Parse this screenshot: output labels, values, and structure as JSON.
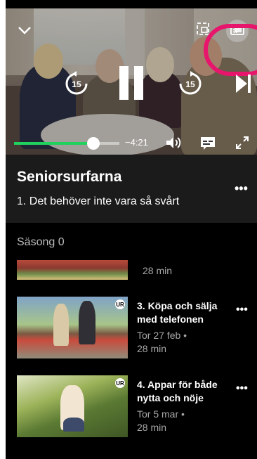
{
  "player": {
    "time_remaining": "−4:21",
    "progress": 0.75,
    "rewind_seconds": "15",
    "forward_seconds": "15",
    "accent_color": "#21d15d",
    "highlight_color": "#e8156d",
    "icons": [
      "chevron-down-icon",
      "picture-in-picture-icon",
      "cast-icon",
      "rewind-15-icon",
      "pause-icon",
      "forward-15-icon",
      "skip-next-icon",
      "volume-icon",
      "subtitles-icon",
      "fullscreen-icon"
    ]
  },
  "program": {
    "title": "Seniorsurfarna",
    "episode_title": "1. Det behöver inte vara så svårt",
    "more_label": "•••"
  },
  "season": {
    "label": "Säsong 0"
  },
  "episodes": [
    {
      "title": "",
      "date": "",
      "duration": "28 min"
    },
    {
      "title": "3. Köpa och sälja med telefonen",
      "date": "Tor 27 feb •",
      "duration": "28 min",
      "badge": "UR"
    },
    {
      "title": "4. Appar för både nytta och nöje",
      "date": "Tor 5 mar •",
      "duration": "28 min",
      "badge": "UR"
    }
  ],
  "more_label": "•••"
}
